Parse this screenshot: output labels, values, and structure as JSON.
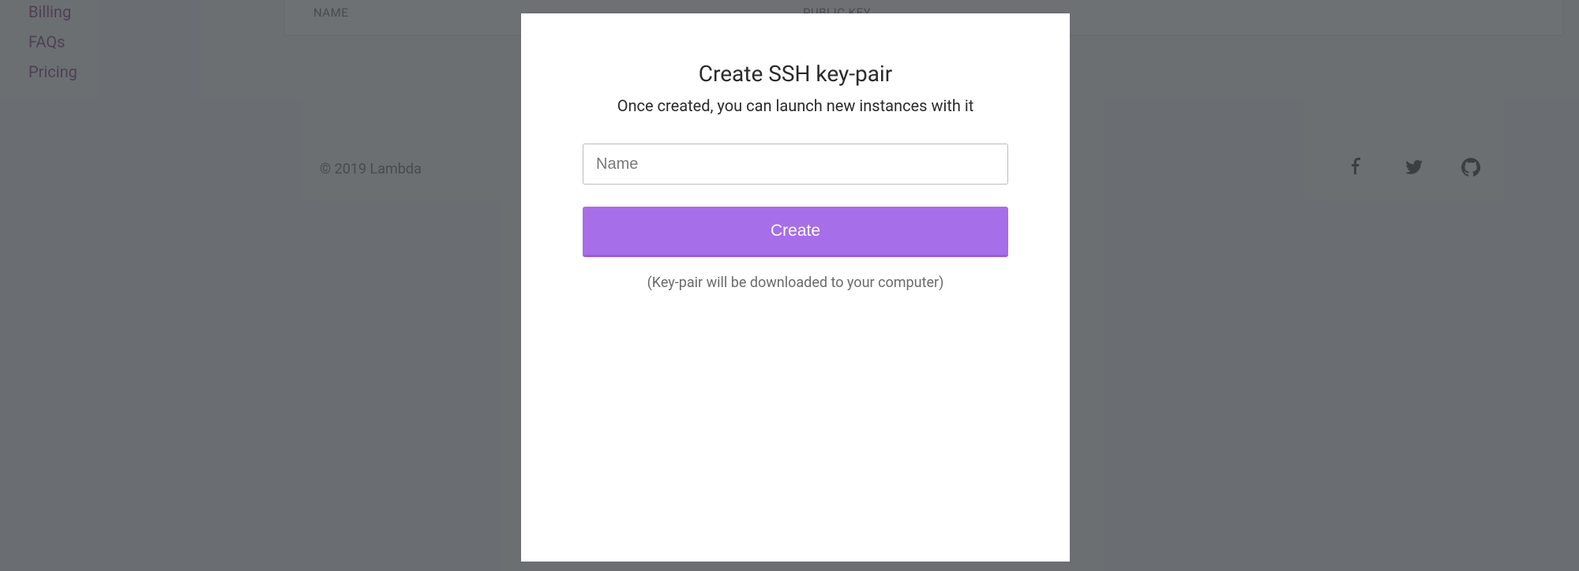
{
  "sidebar": {
    "items": [
      {
        "label": "Billing"
      },
      {
        "label": "FAQs"
      },
      {
        "label": "Pricing"
      }
    ]
  },
  "table": {
    "headers": {
      "name": "NAME",
      "public_key": "PUBLIC KEY"
    }
  },
  "footer": {
    "copyright": "© 2019 Lambda"
  },
  "modal": {
    "title": "Create SSH key-pair",
    "subtitle": "Once created, you can launch new instances with it",
    "name_placeholder": "Name",
    "create_label": "Create",
    "hint": "(Key-pair will be downloaded to your computer)"
  }
}
